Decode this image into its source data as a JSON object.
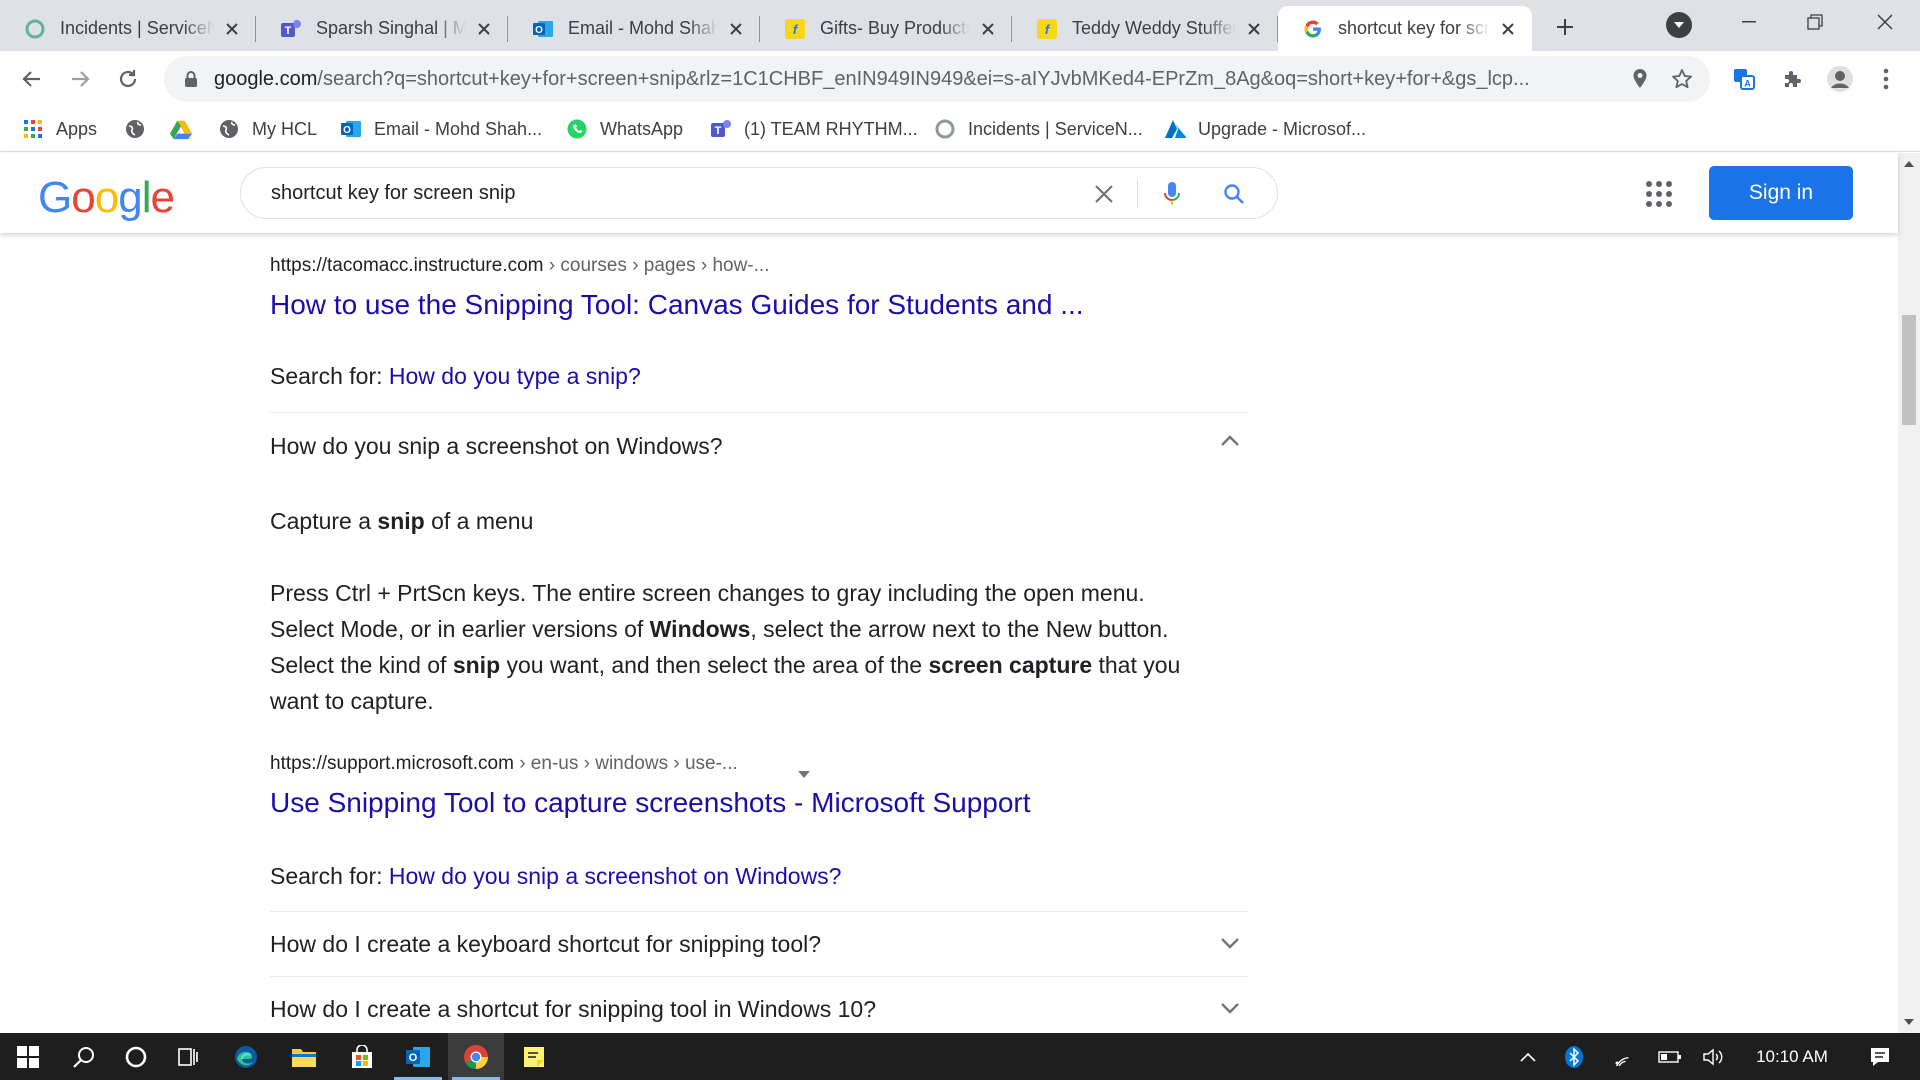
{
  "tabs": [
    {
      "title": "Incidents | ServiceNow",
      "icon": "servicenow-icon"
    },
    {
      "title": "Sparsh Singhal | Microsoft Teams",
      "icon": "teams-icon"
    },
    {
      "title": "Email - Mohd Shahrukh",
      "icon": "outlook-icon"
    },
    {
      "title": "Gifts- Buy Products",
      "icon": "flipkart-icon"
    },
    {
      "title": "Teddy Weddy Stuffed",
      "icon": "flipkart-icon"
    },
    {
      "title": "shortcut key for screen snip",
      "icon": "google-icon",
      "active": true
    }
  ],
  "url": {
    "host": "google.com",
    "rest": "/search?q=shortcut+key+for+screen+snip&rlz=1C1CHBF_enIN949IN949&ei=s-aIYJvbMKed4-EPrZm_8Ag&oq=short+key+for+&gs_lcp..."
  },
  "bookmarks": [
    {
      "label": "Apps",
      "icon": "apps-grid-icon"
    },
    {
      "label": "",
      "icon": "globe-icon"
    },
    {
      "label": "",
      "icon": "google-drive-icon"
    },
    {
      "label": "My HCL",
      "icon": "globe-icon"
    },
    {
      "label": "Email - Mohd Shah...",
      "icon": "outlook-icon"
    },
    {
      "label": "WhatsApp",
      "icon": "whatsapp-icon"
    },
    {
      "label": "(1) TEAM RHYTHM...",
      "icon": "teams-icon"
    },
    {
      "label": "Incidents | ServiceN...",
      "icon": "servicenow-icon"
    },
    {
      "label": "Upgrade - Microsof...",
      "icon": "azure-icon"
    }
  ],
  "google": {
    "logo": [
      "G",
      "o",
      "o",
      "g",
      "l",
      "e"
    ],
    "query": "shortcut key for screen snip",
    "sign_in": "Sign in"
  },
  "results": {
    "r1": {
      "cite_host": "https://tacomacc.instructure.com",
      "cite_path": " › courses › pages › how-...",
      "title": "How to use the Snipping Tool: Canvas Guides for Students and ...",
      "search_for_label": "Search for: ",
      "search_for_query": "How do you type a snip?"
    },
    "faq1": {
      "question": "How do you snip a screenshot on Windows?",
      "heading_pre": "Capture a ",
      "heading_bold": "snip",
      "heading_post": " of a menu",
      "p1": "Press Ctrl + PrtScn keys. The entire screen changes to gray including the open menu.",
      "p2_pre": "Select Mode, or in earlier versions of ",
      "p2_bold": "Windows",
      "p2_post": ", select the arrow next to the New button.",
      "p3_pre": "Select the kind of ",
      "p3_bold1": "snip",
      "p3_mid": " you want, and then select the area of the ",
      "p3_bold2": "screen capture",
      "p3_post": " that you",
      "p4": "want to capture."
    },
    "r2": {
      "cite_host": "https://support.microsoft.com",
      "cite_path": " › en-us › windows › use-...",
      "title": "Use Snipping Tool to capture screenshots - Microsoft Support",
      "search_for_label": "Search for: ",
      "search_for_query": "How do you snip a screenshot on Windows?"
    },
    "faq2": {
      "question": "How do I create a keyboard shortcut for snipping tool?"
    },
    "faq3": {
      "question": "How do I create a shortcut for snipping tool in Windows 10?"
    }
  },
  "taskbar": {
    "clock": "10:10 AM",
    "apps": [
      "windows-start-icon",
      "search-icon",
      "cortana-icon",
      "task-view-icon",
      "edge-icon",
      "file-explorer-icon",
      "store-icon",
      "outlook-icon",
      "chrome-icon",
      "sticky-notes-icon"
    ]
  },
  "colors": {
    "link": "#1a0dab",
    "signin": "#1a73e8",
    "tabstrip": "#dee1e6"
  }
}
